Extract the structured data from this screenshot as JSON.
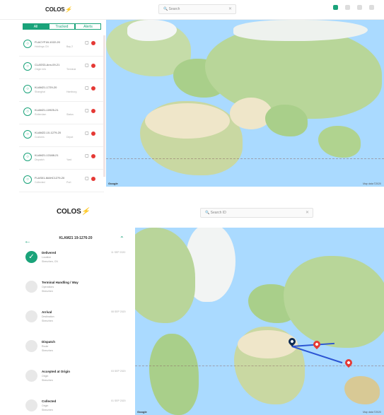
{
  "screen1": {
    "brand": {
      "name": "COLOS",
      "mark": "⚡"
    },
    "search": {
      "placeholder": "🔍 Search",
      "clear": "✕"
    },
    "tabs": [
      {
        "label": "All",
        "active": true
      },
      {
        "label": "Tracked",
        "active": false
      },
      {
        "label": "Alerts",
        "active": false
      }
    ],
    "list": [
      {
        "title": "FLACYF18-1022-20",
        "sub": "Holdings CN",
        "extra": "Bay 2",
        "icon": "document-icon"
      },
      {
        "title": "CLASS3-Ann-09-21",
        "sub": "Origin Info",
        "extra": "Terminal",
        "icon": "document-icon"
      },
      {
        "title": "KLAM21-1729-20",
        "sub": "Shanghai",
        "extra": "Hamburg",
        "icon": "document-icon"
      },
      {
        "title": "KLAM21-10925-21",
        "sub": "Rotterdam",
        "extra": "Status",
        "icon": "document-icon"
      },
      {
        "title": "KLAM22-10-1279-20",
        "sub": "Customs",
        "extra": "Depot",
        "icon": "document-icon"
      },
      {
        "title": "KLAM21-13188-21",
        "sub": "Dispatch",
        "extra": "Yard",
        "icon": "document-icon"
      },
      {
        "title": "FLAS01-MAHC1279-20",
        "sub": "Collected",
        "extra": "Port",
        "icon": "document-icon"
      }
    ],
    "map": {
      "google": "Google",
      "attribution": "Map data ©2020"
    }
  },
  "screen2": {
    "brand": {
      "name": "COLOS",
      "mark": "⚡"
    },
    "search": {
      "placeholder": "🔍 Search ID",
      "clear": "✕"
    },
    "header": {
      "back": "←",
      "title": "KLAM21 19-1276-20",
      "collapse": "⌃"
    },
    "timeline": [
      {
        "title": "Delivered",
        "sub": "Location",
        "note": "Shenzhen, CN",
        "date": "11 SEP 2020",
        "done": true
      },
      {
        "title": "Terminal Handling / Way",
        "sub": "Operations",
        "note": "Shenzhen",
        "date": "",
        "done": false
      },
      {
        "title": "Arrival",
        "sub": "Destination",
        "note": "Shenzhen",
        "date": "08 SEP 2020",
        "done": false
      },
      {
        "title": "Dispatch",
        "sub": "Route",
        "note": "Shenzhen",
        "date": "",
        "done": false
      },
      {
        "title": "Accepted at Origin",
        "sub": "Origin",
        "note": "Shenzhen",
        "date": "03 SEP 2020",
        "done": false
      },
      {
        "title": "Collected",
        "sub": "Origin",
        "note": "Shenzhen",
        "date": "01 SEP 2020",
        "done": false
      }
    ],
    "map": {
      "google": "Google",
      "attribution": "Map data ©2020"
    }
  }
}
